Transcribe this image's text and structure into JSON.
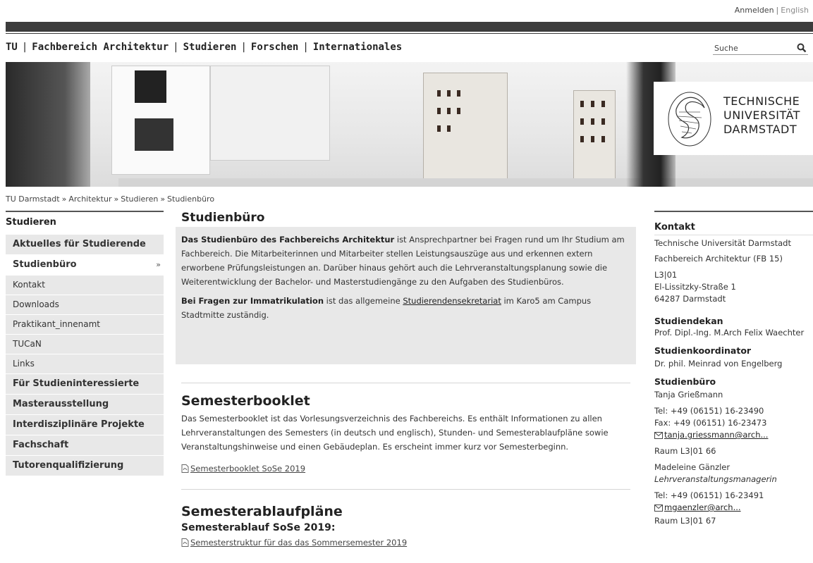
{
  "top_links": {
    "login": "Anmelden",
    "separator": "|",
    "language": "English"
  },
  "main_nav": {
    "items": [
      "TU",
      "Fachbereich Architektur",
      "Studieren",
      "Forschen",
      "Internationales"
    ],
    "separator": "|"
  },
  "search": {
    "placeholder": "Suche",
    "icon": "search-icon"
  },
  "logo": {
    "line1": "TECHNISCHE",
    "line2": "UNIVERSITÄT",
    "line3": "DARMSTADT"
  },
  "breadcrumb": {
    "items": [
      "TU Darmstadt",
      "Architektur",
      "Studieren",
      "Studienbüro"
    ],
    "separator": "»"
  },
  "leftnav": {
    "heading": "Studieren",
    "items": [
      {
        "label": "Aktuelles für Studierende"
      },
      {
        "label": "Studienbüro",
        "chevron": "»"
      },
      {
        "label": "Kontakt"
      },
      {
        "label": "Downloads"
      },
      {
        "label": "Praktikant_innenamt"
      },
      {
        "label": "TUCaN"
      },
      {
        "label": "Links"
      },
      {
        "label": "Für Studieninteressierte"
      },
      {
        "label": "Masterausstellung"
      },
      {
        "label": "Interdisziplinäre Projekte"
      },
      {
        "label": "Fachschaft"
      },
      {
        "label": "Tutorenqualifizierung"
      }
    ]
  },
  "content": {
    "title": "Studienbüro",
    "intro": {
      "p1_bold": "Das Studienbüro des Fachbereichs Architektur",
      "p1_rest": " ist Ansprechpartner bei Fragen rund um Ihr Studium am Fachbereich. Die Mitarbeiterinnen und Mitarbeiter stellen Leistungsauszüge aus und erkennen extern erworbene Prüfungsleistungen an. Darüber hinaus gehört auch die Lehrveranstaltungsplanung sowie die Weiterentwicklung der Bachelor- und Masterstudiengänge zu den Aufgaben des Studienbüros.",
      "p2_bold": "Bei Fragen zur Immatrikulation",
      "p2_mid": " ist das allgemeine ",
      "p2_link": "Studierendensekretariat",
      "p2_end": " im Karo5 am Campus Stadtmitte zuständig."
    },
    "booklet": {
      "title": "Semesterbooklet",
      "text": "Das Semesterbooklet ist das Vorlesungsverzeichnis des Fachbereichs. Es enthält Informationen zu allen Lehrveranstaltungen des Semesters (in deutsch und englisch), Stunden- und Semesterablaufpläne sowie Veranstaltungshinweise und einen Gebäudeplan. Es erscheint immer kurz vor Semesterbeginn.",
      "link": "Semesterbooklet SoSe 2019"
    },
    "ablauf": {
      "title": "Semesterablaufpläne",
      "subtitle": "Semesterablauf SoSe 2019:",
      "link": "Semesterstruktur für das das Sommersemester 2019"
    }
  },
  "sidebar": {
    "heading": "Kontakt",
    "org1": "Technische Universität Darmstadt",
    "org2": "Fachbereich Architektur (FB 15)",
    "room": "L3|01",
    "street": "El-Lissitzky-Straße 1",
    "city": "64287 Darmstadt",
    "dekan_label": "Studiendekan",
    "dekan_name": "Prof. Dipl.-Ing. M.Arch Felix Waechter",
    "koord_label": "Studienkoordinator",
    "koord_name": "Dr. phil. Meinrad von Engelberg",
    "buero_label": "Studienbüro",
    "p1_name": "Tanja Grießmann",
    "p1_tel": "Tel: +49 (06151) 16-23490",
    "p1_fax": "Fax: +49 (06151) 16-23473",
    "p1_mail": "tanja.griessmann@arch...",
    "p1_room": "Raum L3|01 66",
    "p2_name": "Madeleine Gänzler",
    "p2_role": "Lehrveranstaltungsmanagerin",
    "p2_tel": "Tel: +49 (06151) 16-23491",
    "p2_mail": "mgaenzler@arch...",
    "p2_room": "Raum L3|01 67"
  }
}
